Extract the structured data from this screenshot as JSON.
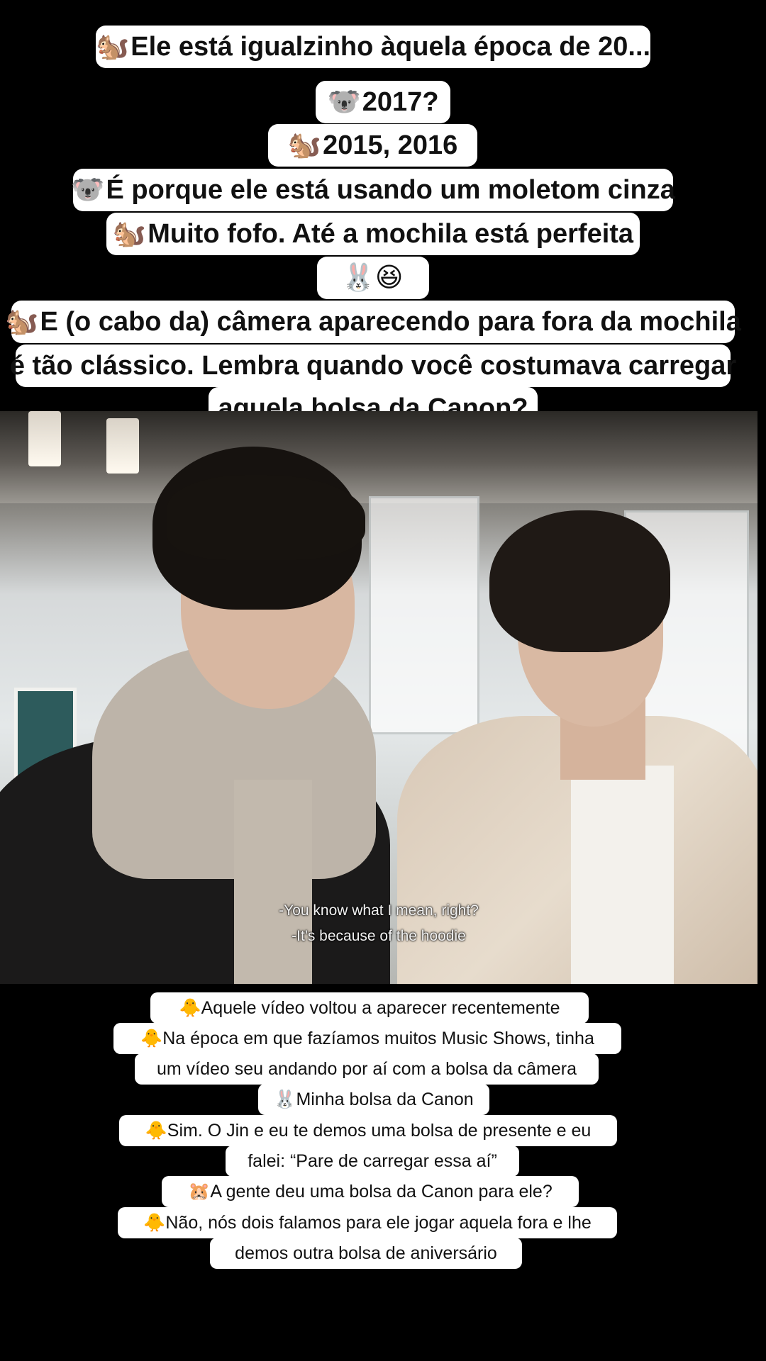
{
  "top_captions": [
    {
      "emoji": "🐿️",
      "text": "Ele está igualzinho àquela época de 20..."
    },
    {
      "emoji": "🐨",
      "text": "2017?"
    },
    {
      "emoji": "🐿️",
      "text": "2015, 2016"
    },
    {
      "emoji": "🐨",
      "text": "É porque ele está usando um moletom cinza"
    },
    {
      "emoji": "🐿️",
      "text": "Muito fofo. Até a mochila está perfeita"
    },
    {
      "emoji": "🐰😆",
      "text": ""
    },
    {
      "emoji": "🐿️",
      "text": "E (o cabo da) câmera aparecendo para fora da mochila"
    },
    {
      "emoji": "",
      "text": "é tão clássico. Lembra quando você costumava carregar"
    },
    {
      "emoji": "",
      "text": "aquela bolsa da Canon?"
    }
  ],
  "video": {
    "subtitle_line1": "-You know what I mean, right?",
    "subtitle_line2": "-It's because of the hoodie"
  },
  "bottom_captions": [
    {
      "emoji": "🐥",
      "text": "Aquele vídeo voltou a aparecer recentemente"
    },
    {
      "emoji": "🐥",
      "text": "Na época em que fazíamos muitos Music Shows, tinha"
    },
    {
      "emoji": "",
      "text": "um vídeo seu andando por aí com a bolsa da câmera"
    },
    {
      "emoji": "🐰",
      "text": "Minha bolsa da Canon"
    },
    {
      "emoji": "🐥",
      "text": "Sim. O Jin e eu te demos uma bolsa de presente e eu"
    },
    {
      "emoji": "",
      "text": "falei: “Pare de carregar essa aí”"
    },
    {
      "emoji": "🐹",
      "text": "A gente deu uma bolsa da Canon para ele?"
    },
    {
      "emoji": "🐥",
      "text": "Não, nós dois falamos para ele jogar aquela fora e lhe"
    },
    {
      "emoji": "",
      "text": "demos outra bolsa de aniversário"
    }
  ]
}
